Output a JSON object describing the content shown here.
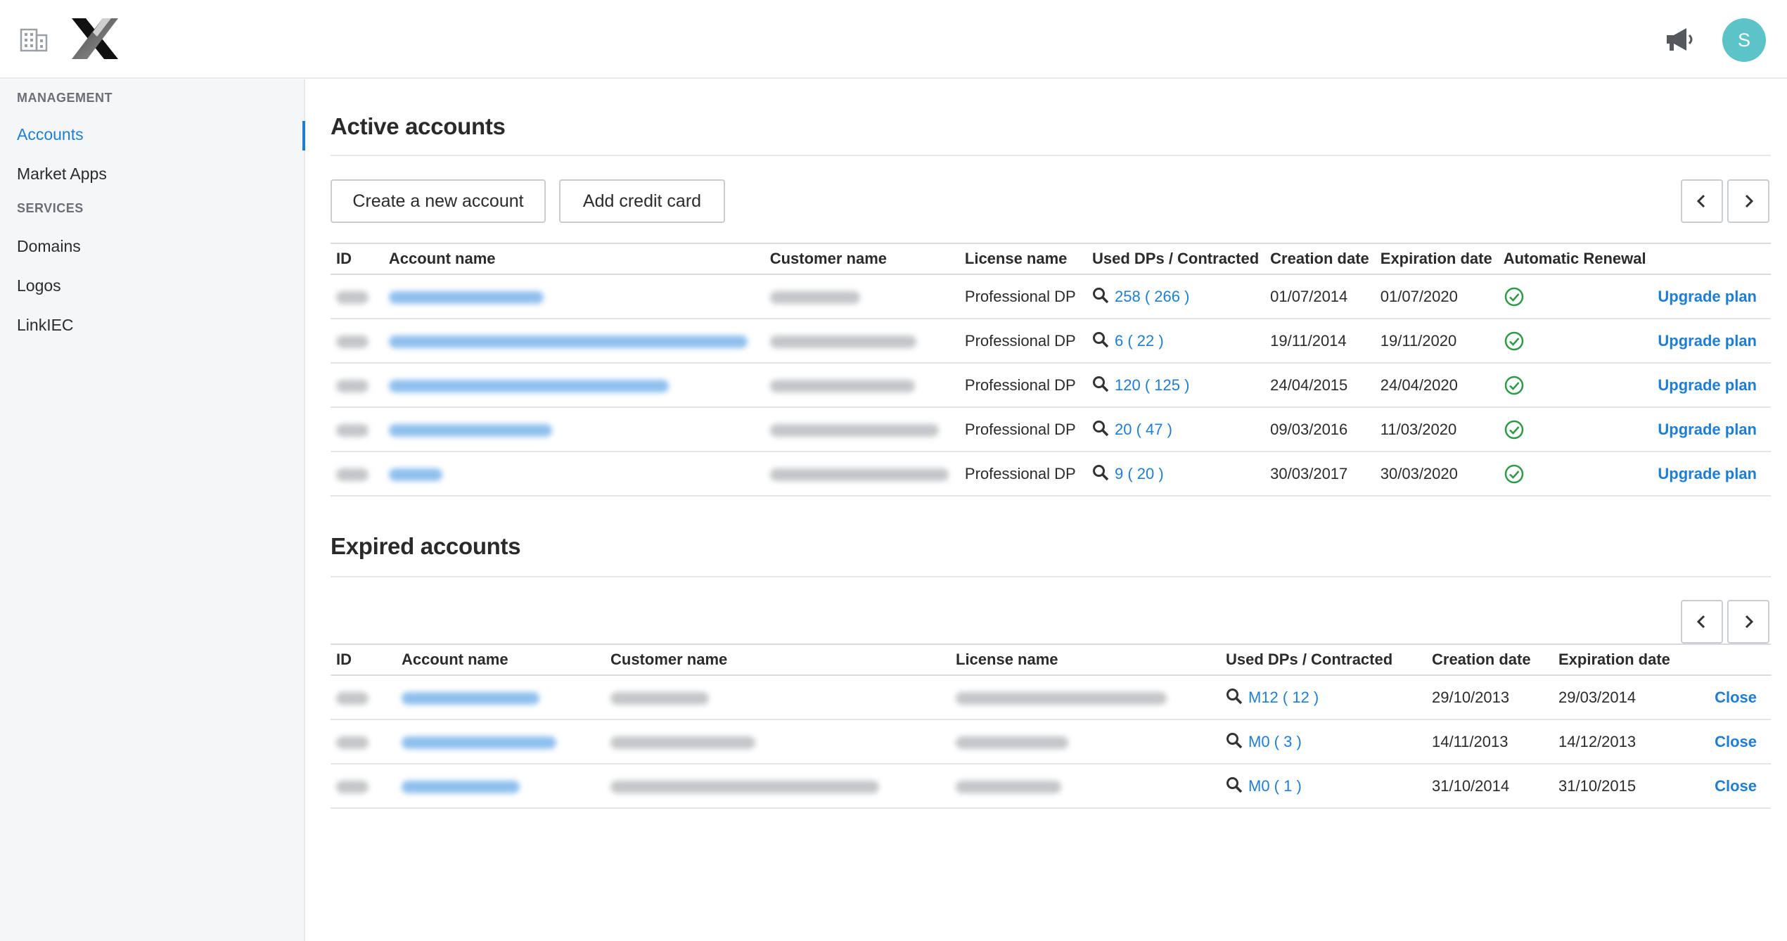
{
  "header": {
    "avatar_initial": "S"
  },
  "sidebar": {
    "management_title": "MANAGEMENT",
    "services_title": "SERVICES",
    "items": [
      {
        "label": "Accounts",
        "active": true
      },
      {
        "label": "Market Apps"
      },
      {
        "label": "Domains"
      },
      {
        "label": "Logos"
      },
      {
        "label": "LinkIEC"
      }
    ]
  },
  "active": {
    "title": "Active accounts",
    "create_button": "Create a new account",
    "credit_button": "Add credit card",
    "columns": [
      "ID",
      "Account name",
      "Customer name",
      "License name",
      "Used DPs / Contracted",
      "Creation date",
      "Expiration date",
      "Automatic Renewal"
    ],
    "rows": [
      {
        "license": "Professional DP",
        "dps": "258 ( 266 )",
        "created": "01/07/2014",
        "expires": "01/07/2020",
        "action": "Upgrade plan"
      },
      {
        "license": "Professional DP",
        "dps": "6 ( 22 )",
        "created": "19/11/2014",
        "expires": "19/11/2020",
        "action": "Upgrade plan"
      },
      {
        "license": "Professional DP",
        "dps": "120 ( 125 )",
        "created": "24/04/2015",
        "expires": "24/04/2020",
        "action": "Upgrade plan"
      },
      {
        "license": "Professional DP",
        "dps": "20 ( 47 )",
        "created": "09/03/2016",
        "expires": "11/03/2020",
        "action": "Upgrade plan"
      },
      {
        "license": "Professional DP",
        "dps": "9 ( 20 )",
        "created": "30/03/2017",
        "expires": "30/03/2020",
        "action": "Upgrade plan"
      }
    ]
  },
  "expired": {
    "title": "Expired accounts",
    "columns": [
      "ID",
      "Account name",
      "Customer name",
      "License name",
      "Used DPs / Contracted",
      "Creation date",
      "Expiration date"
    ],
    "rows": [
      {
        "dps": "M12 ( 12 )",
        "created": "29/10/2013",
        "expires": "29/03/2014",
        "action": "Close"
      },
      {
        "dps": "M0 ( 3 )",
        "created": "14/11/2013",
        "expires": "14/12/2013",
        "action": "Close"
      },
      {
        "dps": "M0 ( 1 )",
        "created": "31/10/2014",
        "expires": "31/10/2015",
        "action": "Close"
      }
    ]
  },
  "colors": {
    "accent": "#1f7ed4",
    "avatar": "#5cc3c9",
    "check": "#2e9a48"
  }
}
